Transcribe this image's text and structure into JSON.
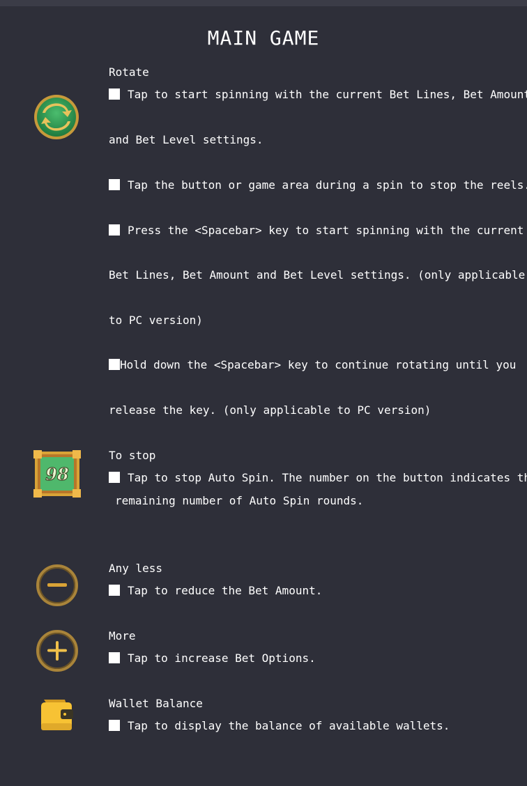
{
  "title": "MAIN GAME",
  "sections": {
    "rotate": {
      "heading": "Rotate",
      "icon": "spin-icon",
      "lines": [
        "Tap to start spinning with the current Bet Lines, Bet Amount",
        "and Bet Level settings.",
        "Tap the button or game area during a spin to stop the reels.",
        "Press the <Spacebar> key to start spinning with the current",
        "Bet Lines, Bet Amount and Bet Level settings. (only applicable",
        "to PC version)",
        "Hold down the <Spacebar> key to continue rotating until you",
        "release the key. (only applicable to PC version)"
      ]
    },
    "stop": {
      "heading": "To stop",
      "icon": "auto-spin-counter-icon",
      "counter": "98",
      "lines": [
        "Tap to stop Auto Spin. The number on the button indicates the",
        "remaining number of Auto Spin rounds."
      ]
    },
    "less": {
      "heading": "Any less",
      "icon": "minus-icon",
      "lines": [
        "Tap to reduce the Bet Amount."
      ]
    },
    "more": {
      "heading": "More",
      "icon": "plus-icon",
      "lines": [
        "Tap to increase Bet Options."
      ]
    },
    "wallet": {
      "heading": "Wallet Balance",
      "icon": "wallet-icon",
      "lines": [
        "Tap to display the balance of available wallets."
      ]
    }
  },
  "colors": {
    "background": "#2e2f39",
    "spin_green": "#2f9a55",
    "gold": "#d9a336",
    "counter_green": "#4fb86c",
    "wallet_yellow": "#f7c234"
  }
}
